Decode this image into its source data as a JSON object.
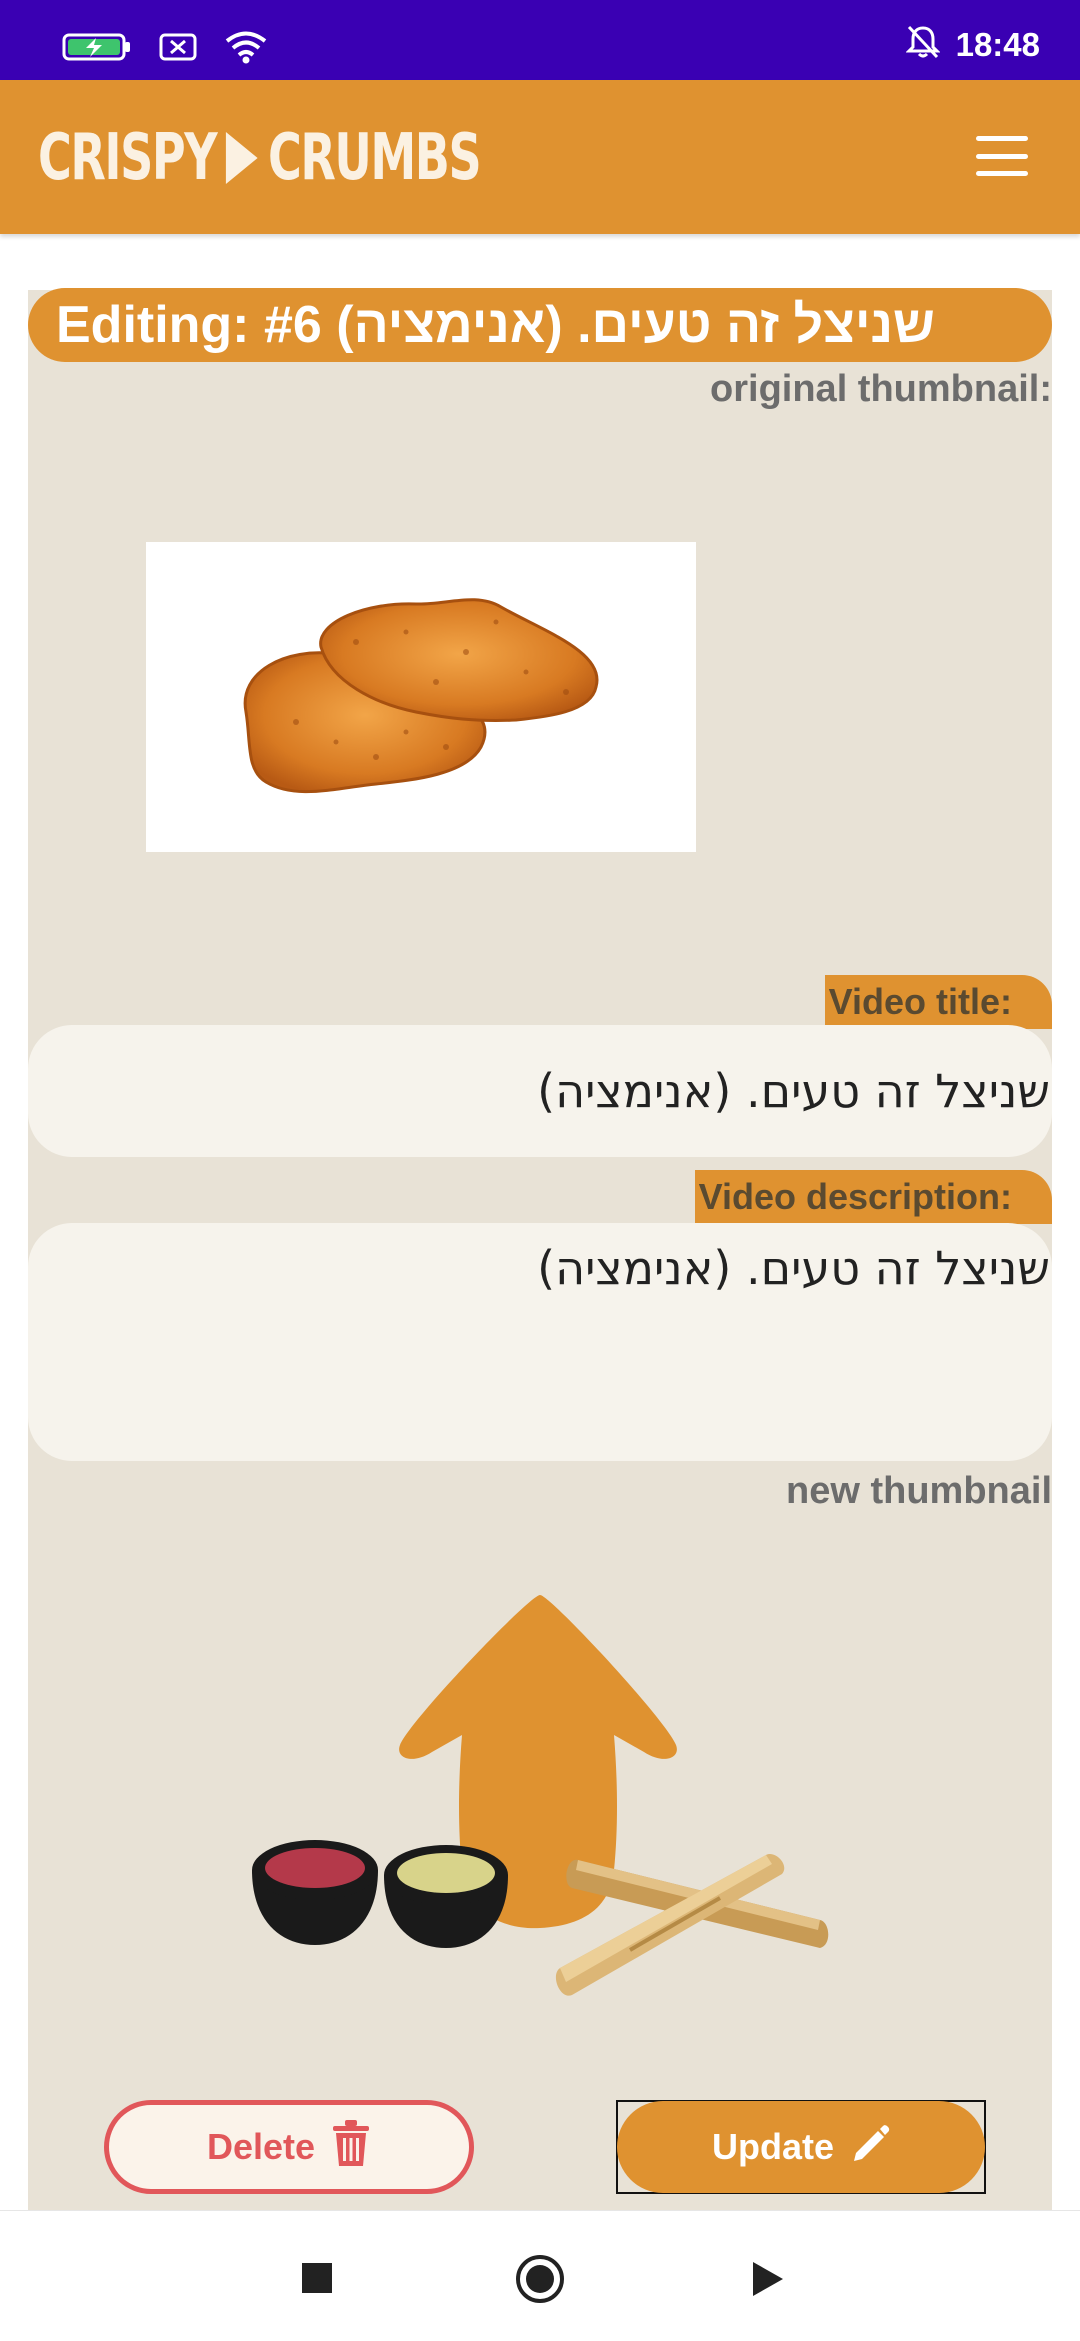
{
  "status_bar": {
    "time": "18:48",
    "icons": [
      "battery-charging-icon",
      "no-sim-icon",
      "wifi-icon",
      "notifications-off-icon"
    ]
  },
  "app_bar": {
    "logo_left": "CRISPY",
    "logo_right": "CRUMBS",
    "menu_icon": "hamburger-menu-icon"
  },
  "editor": {
    "heading": "Editing: #6 שניצל זה טעים. (אנימציה)",
    "original_thumbnail_label": "original thumbnail:",
    "video_title_label": "Video title:",
    "video_title_value": "שניצל זה טעים. (אנימציה)",
    "video_description_label": "Video description:",
    "video_description_value": "שניצל זה טעים. (אנימציה)",
    "new_thumbnail_label": "new thumbnail",
    "delete_label": "Delete",
    "update_label": "Update"
  },
  "colors": {
    "status_bar": "#3a00b3",
    "accent": "#df9230",
    "panel": "#e8e2d6",
    "field": "#f6f3ec",
    "danger": "#e1575a"
  },
  "nav_bar": {
    "icons": [
      "recents-square-icon",
      "home-circle-icon",
      "back-triangle-icon"
    ]
  }
}
